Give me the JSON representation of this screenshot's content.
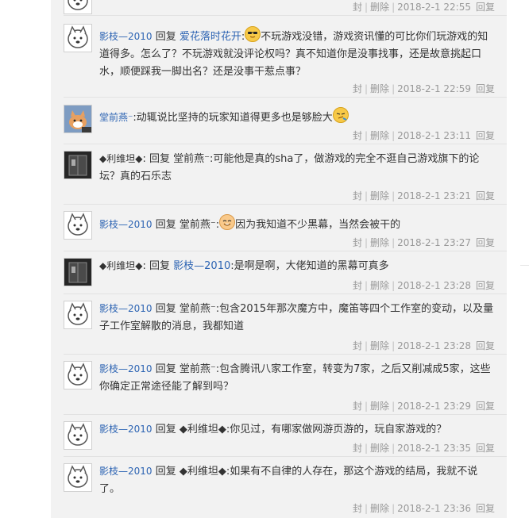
{
  "actions": {
    "seal": "封",
    "delete": "删除",
    "reply": "回复"
  },
  "posts": [
    {
      "user": "",
      "reply_word": "",
      "target": "",
      "text_a": "",
      "text_b": "",
      "time": "2018-2-1 22:55"
    },
    {
      "user": "影枝—2010",
      "reply_word": "回复",
      "target": "爱花落时花开",
      "text_a": ":",
      "text_b": "不玩游戏没错，游戏资讯懂的可比你们玩游戏的知道得多。怎么了？不玩游戏就没评论权吗？真不知道你是没事找事，还是故意挑起口水，顺便踩我一脚出名？还是没事干惹点事？",
      "time": "2018-2-1 22:59"
    },
    {
      "user": "堂前燕⁻",
      "reply_word": "",
      "target": "",
      "text_a": ":动辄说比坚持的玩家知道得更多也是够脸大",
      "text_b": "",
      "time": "2018-2-1 23:11"
    },
    {
      "user": "◆利维坦◆",
      "reply_word": "回复",
      "target": "堂前燕⁻",
      "text_a": ":可能他是真的sha了，做游戏的完全不逛自己游戏旗下的论坛？真的石乐志",
      "text_b": "",
      "time": "2018-2-1 23:21"
    },
    {
      "user": "影枝—2010",
      "reply_word": "回复",
      "target": "堂前燕⁻",
      "text_a": ":",
      "text_b": "因为我知道不少黑幕，当然会被干的",
      "time": "2018-2-1 23:27"
    },
    {
      "user": "◆利维坦◆",
      "reply_word": "回复",
      "target": "影枝—2010",
      "text_a": ":是啊是啊，大佬知道的黑幕可真多",
      "text_b": "",
      "time": "2018-2-1 23:28"
    },
    {
      "user": "影枝—2010",
      "reply_word": "回复",
      "target": "堂前燕⁻",
      "text_a": ":包含2015年那次魔方中，魔笛等四个工作室的变动，以及量子工作室解散的消息，我都知道",
      "text_b": "",
      "time": "2018-2-1 23:28"
    },
    {
      "user": "影枝—2010",
      "reply_word": "回复",
      "target": "堂前燕⁻",
      "text_a": ":包含腾讯八家工作室，转变为7家，之后又削减成5家，这些你确定正常途径能了解到吗？",
      "text_b": "",
      "time": "2018-2-1 23:29"
    },
    {
      "user": "影枝—2010",
      "reply_word": "回复",
      "target": "◆利维坦◆",
      "text_a": ":你见过，有哪家做网游页游的，玩自家游戏的？",
      "text_b": "",
      "time": "2018-2-1 23:35"
    },
    {
      "user": "影枝—2010",
      "reply_word": "回复",
      "target": "◆利维坦◆",
      "text_a": ":如果有不自律的人存在，那这个游戏的结局，我就不说了。",
      "text_b": "",
      "time": "2018-2-1 23:36"
    }
  ]
}
